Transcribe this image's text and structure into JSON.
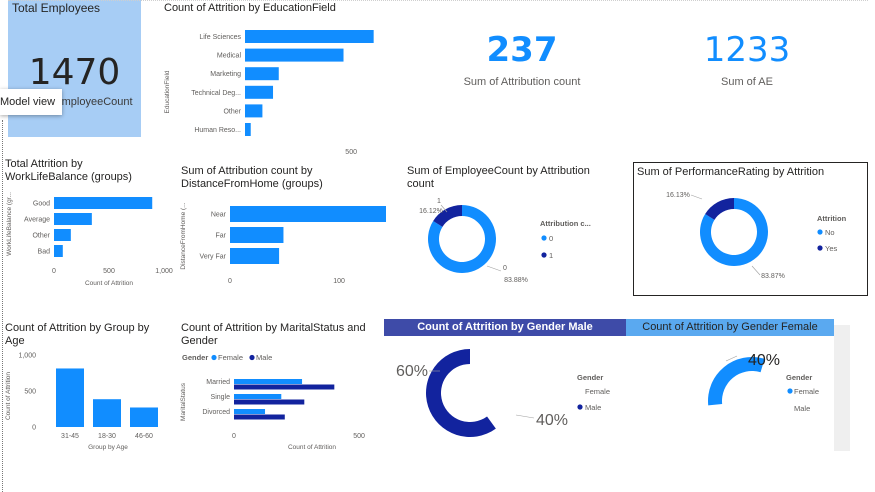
{
  "colors": {
    "primary": "#118dff",
    "dark": "#12239e",
    "card_blue": "#a7cdf5",
    "banner_dark": "#3e4ba8",
    "banner_light": "#5aa9f0"
  },
  "total_employees": {
    "title": "Total Employees",
    "value": "1470",
    "label": "Sum of EmployeeCount",
    "tooltip": "Model view"
  },
  "kpis": [
    {
      "value": "237",
      "label": "Sum of Attribution count"
    },
    {
      "value": "1233",
      "label": "Sum of AE"
    }
  ],
  "titles": {
    "education": "Count of Attrition by EducationField",
    "wlb_line1": "Total Attrition by",
    "wlb_line2": "WorkLifeBalance (groups)",
    "distance_line1": "Sum of Attribution count by",
    "distance_line2": "DistanceFromHome (groups)",
    "empcount_line1": "Sum of EmployeeCount by Attribution",
    "empcount_line2": "count",
    "perf": "Sum of PerformanceRating by Attrition",
    "age_line1": "Count of Attrition by Group by",
    "age_line2": "Age",
    "marital_line1": "Count of Attrition by MaritalStatus and",
    "marital_line2": "Gender",
    "gender_male": "Count of Attrition by Gender Male",
    "gender_female": "Count of Attrition by Gender Female"
  },
  "chart_data": [
    {
      "id": "education",
      "type": "bar",
      "orientation": "horizontal",
      "title": "Count of Attrition by EducationField",
      "ylabel": "EducationField",
      "categories": [
        "Life Sciences",
        "Medical",
        "Marketing",
        "Technical Deg...",
        "Other",
        "Human Reso..."
      ],
      "values": [
        606,
        464,
        159,
        132,
        82,
        27
      ],
      "xlim": [
        0,
        650
      ],
      "xticks": [
        "500"
      ]
    },
    {
      "id": "wlb",
      "type": "bar",
      "orientation": "horizontal",
      "title": "Total Attrition by WorkLifeBalance (groups)",
      "xlabel": "Count of Attrition",
      "ylabel": "WorkLifeBalance (gr...",
      "categories": [
        "Good",
        "Average",
        "Other",
        "Bad"
      ],
      "values": [
        893,
        344,
        153,
        80
      ],
      "xlim": [
        0,
        1000
      ],
      "xticks": [
        "0",
        "500",
        "1,000"
      ]
    },
    {
      "id": "distance",
      "type": "bar",
      "orientation": "horizontal",
      "title": "Sum of Attribution count by DistanceFromHome (groups)",
      "ylabel": "DistanceFromHome (...",
      "categories": [
        "Near",
        "Far",
        "Very Far"
      ],
      "values": [
        143,
        49,
        45
      ],
      "xlim": [
        0,
        143
      ],
      "xticks": [
        "0",
        "100"
      ]
    },
    {
      "id": "empcount",
      "type": "pie",
      "title": "Sum of EmployeeCount by Attribution count",
      "legend_title": "Attribution c...",
      "categories": [
        "0",
        "1"
      ],
      "values": [
        83.88,
        16.12
      ],
      "labels": [
        "83.88%",
        "16.12%"
      ],
      "outer_labels": [
        "0",
        "1"
      ]
    },
    {
      "id": "perf",
      "type": "pie",
      "title": "Sum of PerformanceRating by Attrition",
      "legend_title": "Attrition",
      "categories": [
        "No",
        "Yes"
      ],
      "values": [
        83.87,
        16.13
      ],
      "labels": [
        "83.87%",
        "16.13%"
      ]
    },
    {
      "id": "age",
      "type": "bar",
      "title": "Count of Attrition by Group by Age",
      "xlabel": "Group by Age",
      "ylabel": "Count of Attrition",
      "categories": [
        "31-45",
        "18-30",
        "46-60"
      ],
      "values": [
        813,
        386,
        271
      ],
      "ylim": [
        0,
        1000
      ],
      "yticks": [
        "0",
        "500",
        "1,000"
      ]
    },
    {
      "id": "marital",
      "type": "bar",
      "orientation": "horizontal",
      "title": "Count of Attrition by MaritalStatus and Gender",
      "xlabel": "Count of Attrition",
      "ylabel": "MaritalStatus",
      "legend_title": "Gender",
      "categories": [
        "Married",
        "Single",
        "Divorced"
      ],
      "series": [
        {
          "name": "Female",
          "values": [
            272,
            189,
            124
          ]
        },
        {
          "name": "Male",
          "values": [
            401,
            281,
            203
          ]
        }
      ],
      "xlim": [
        0,
        550
      ],
      "xticks": [
        "0",
        "500"
      ]
    },
    {
      "id": "gender_male",
      "type": "pie",
      "title": "Count of Attrition by Gender Male",
      "legend_title": "Gender",
      "categories": [
        "Female",
        "Male"
      ],
      "values": [
        40,
        60
      ],
      "labels": [
        "40%",
        "60%"
      ]
    },
    {
      "id": "gender_female",
      "type": "pie",
      "title": "Count of Attrition by Gender Female",
      "legend_title": "Gender",
      "categories": [
        "Female",
        "Male"
      ],
      "values": [
        40,
        60
      ],
      "labels": [
        "40%"
      ]
    }
  ]
}
